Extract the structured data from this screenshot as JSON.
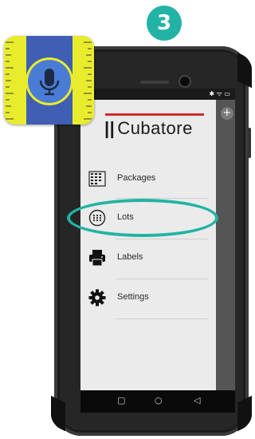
{
  "step": {
    "number": "3"
  },
  "colors": {
    "accent": "#23b3a4",
    "brand_red": "#d22a2a",
    "app_icon_yellow": "#e9ec2d",
    "app_icon_blue": "#3e5fb4"
  },
  "app_icon": {
    "icon": "microphone-icon"
  },
  "status_bar": {
    "time": "02",
    "icons": "✱ ᯤ ▭"
  },
  "drawer": {
    "brand": {
      "bars": "||",
      "name": "Cubatore"
    },
    "items": [
      {
        "label": "Packages",
        "icon": "packages-grid-icon"
      },
      {
        "label": "Lots",
        "icon": "lots-dots-icon",
        "highlighted": true
      },
      {
        "label": "Labels",
        "icon": "printer-icon"
      },
      {
        "label": "Settings",
        "icon": "gear-icon"
      }
    ]
  },
  "fab": {
    "label": "+"
  },
  "nav_bar": {
    "recents": "▢",
    "home": "○",
    "back": "◁"
  }
}
